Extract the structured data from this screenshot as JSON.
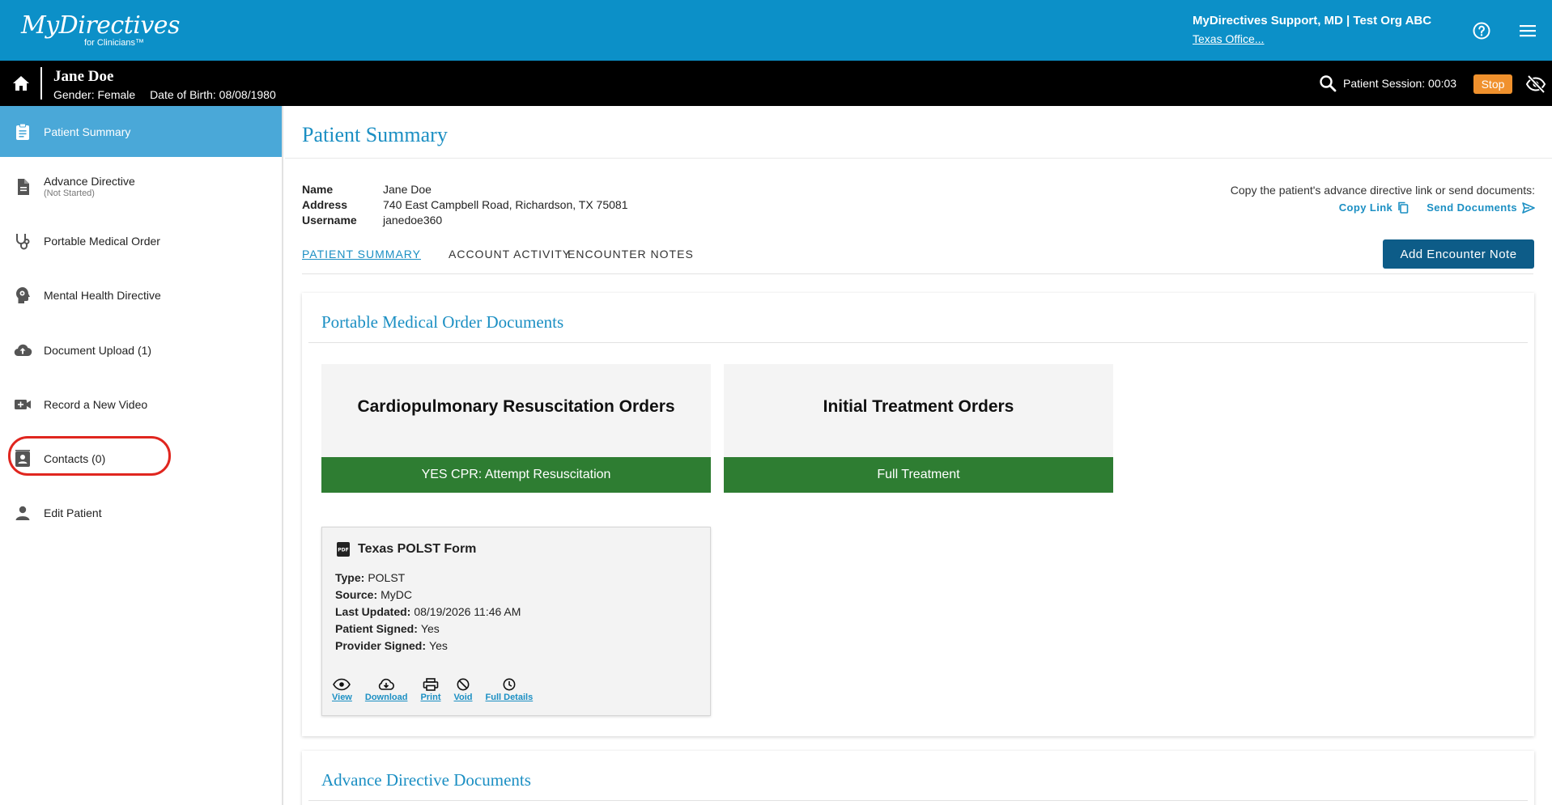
{
  "header": {
    "logo_brand": "MyDirectives",
    "logo_sub": "for Clinicians™",
    "user_name": "MyDirectives Support, MD | Test Org ABC",
    "org_link": "Texas Office..."
  },
  "patient": {
    "name": "Jane Doe",
    "gender": "Gender: Female",
    "dob": "Date of Birth: 08/08/1980",
    "session": "Patient Session: 00:03",
    "stop_label": "Stop"
  },
  "sidebar": {
    "items": [
      {
        "label": "Patient Summary",
        "sub": ""
      },
      {
        "label": "Advance Directive",
        "sub": "(Not Started)"
      },
      {
        "label": "Portable Medical Order",
        "sub": ""
      },
      {
        "label": "Mental Health Directive",
        "sub": ""
      },
      {
        "label": "Document Upload (1)",
        "sub": ""
      },
      {
        "label": "Record a New Video",
        "sub": ""
      },
      {
        "label": "Contacts (0)",
        "sub": ""
      },
      {
        "label": "Edit Patient",
        "sub": ""
      }
    ]
  },
  "main": {
    "title": "Patient Summary",
    "info": [
      {
        "label": "Name",
        "value": "Jane Doe"
      },
      {
        "label": "Address",
        "value": "740 East Campbell Road, Richardson, TX 75081"
      },
      {
        "label": "Username",
        "value": "janedoe360"
      }
    ],
    "share_text": "Copy the patient's advance directive link or send documents:",
    "copy_link": "Copy Link",
    "send_documents": "Send Documents",
    "tabs": [
      {
        "label": "PATIENT SUMMARY"
      },
      {
        "label": "ACCOUNT ACTIVITY"
      },
      {
        "label": "ENCOUNTER NOTES"
      }
    ],
    "add_note_label": "Add Encounter Note",
    "pmo_section_title": "Portable Medical Order Documents",
    "orders": [
      {
        "title": "Cardiopulmonary Resuscitation Orders",
        "status": "YES CPR: Attempt Resuscitation"
      },
      {
        "title": "Initial Treatment Orders",
        "status": "Full Treatment"
      }
    ],
    "document": {
      "title": "Texas POLST Form",
      "fields": [
        {
          "label": "Type:",
          "value": "POLST"
        },
        {
          "label": "Source:",
          "value": "MyDC"
        },
        {
          "label": "Last Updated:",
          "value": "08/19/2026 11:46 AM"
        },
        {
          "label": "Patient Signed:",
          "value": "Yes"
        },
        {
          "label": "Provider Signed:",
          "value": "Yes"
        }
      ],
      "actions": [
        {
          "label": "View",
          "icon": "eye-icon"
        },
        {
          "label": "Download",
          "icon": "cloud-download-icon"
        },
        {
          "label": "Print",
          "icon": "printer-icon"
        },
        {
          "label": "Void",
          "icon": "void-icon"
        },
        {
          "label": "Full Details",
          "icon": "clock-icon"
        }
      ]
    },
    "ad_section_title": "Advance Directive Documents"
  },
  "colors": {
    "top_bar": "#0c90c8",
    "active_nav": "#4aa8d8",
    "accent": "#1b8fc3",
    "status_green": "#2e7d32",
    "stop_orange": "#f0912d",
    "button_navy": "#0d5c88",
    "highlight_red": "#e0261f"
  }
}
